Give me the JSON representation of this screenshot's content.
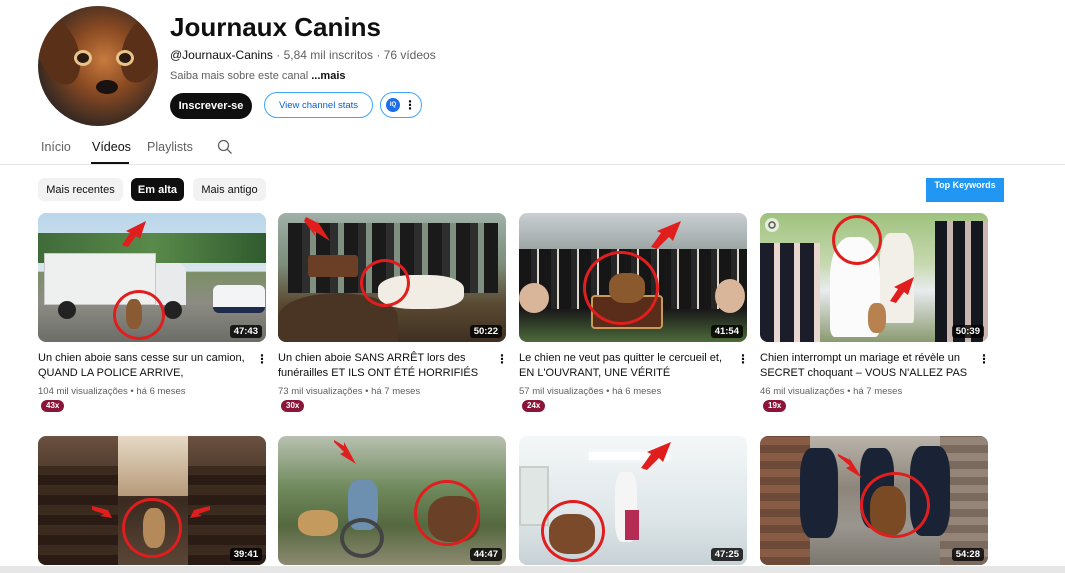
{
  "channel": {
    "name": "Journaux Canins",
    "handle": "@Journaux-Canins",
    "subscribers": "5,84 mil inscritos",
    "videos_count": "76 vídeos",
    "about": "Saiba mais sobre este canal",
    "about_more": "...mais",
    "subscribe_label": "Inscrever-se",
    "stats_label": "View channel stats",
    "ext_icon_text": "IQ",
    "separator": "·"
  },
  "tabs": [
    "Início",
    "Vídeos",
    "Playlists"
  ],
  "active_tab": "Vídeos",
  "chips": [
    "Mais recentes",
    "Em alta",
    "Mais antigo"
  ],
  "active_chip": "Em alta",
  "top_keywords_label": "Top Keywords",
  "videos": [
    {
      "title": "Un chien aboie sans cesse sur un camion, QUAND LA POLICE ARRIVE, DÉCOUVERT U...",
      "views": "104 mil visualizações",
      "age": "há 6 meses",
      "duration": "47:43",
      "badge": "43x"
    },
    {
      "title": "Un chien aboie SANS ARRÊT lors des funérailles ET ILS ONT ÉTÉ HORRIFIÉS PAR...",
      "views": "73 mil visualizações",
      "age": "há 7 meses",
      "duration": "50:22",
      "badge": "30x"
    },
    {
      "title": "Le chien ne veut pas quitter le cercueil et, EN L'OUVRANT, UNE VÉRITÉ CHOQUANTE A...",
      "views": "57 mil visualizações",
      "age": "há 6 meses",
      "duration": "41:54",
      "badge": "24x"
    },
    {
      "title": "Chien interrompt un mariage et révèle un SECRET choquant – VOUS N'ALLEZ PAS Y...",
      "views": "46 mil visualizações",
      "age": "há 7 meses",
      "duration": "50:39",
      "badge": "19x"
    },
    {
      "title": "",
      "views": "",
      "age": "",
      "duration": "39:41",
      "badge": ""
    },
    {
      "title": "",
      "views": "",
      "age": "",
      "duration": "44:47",
      "badge": ""
    },
    {
      "title": "",
      "views": "",
      "age": "",
      "duration": "47:25",
      "badge": ""
    },
    {
      "title": "",
      "views": "",
      "age": "",
      "duration": "54:28",
      "badge": ""
    }
  ],
  "colors": {
    "accent_blue": "#065fd4",
    "badge": "#8b1538",
    "annotation_red": "#e01e1e",
    "top_keywords_bg": "#2196f3"
  }
}
